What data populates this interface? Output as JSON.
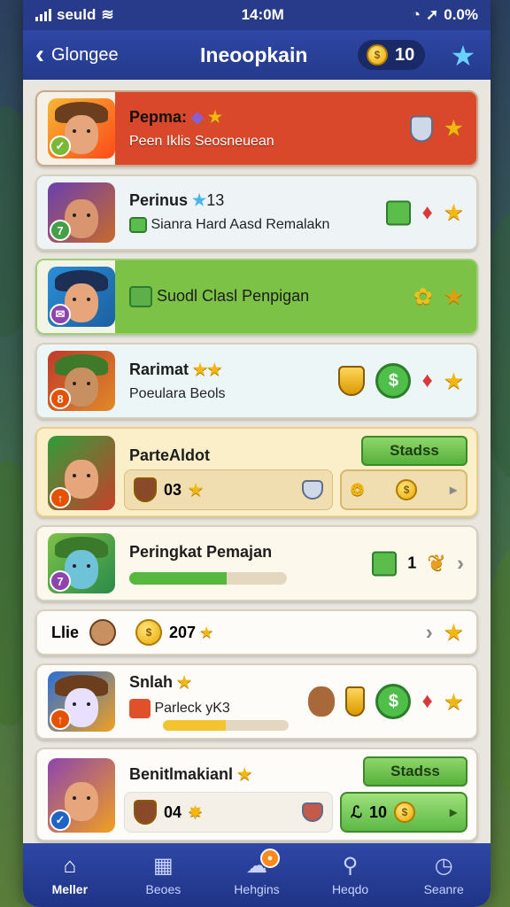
{
  "status_bar": {
    "carrier": "seuld",
    "time": "14:0M",
    "battery": "0.0%"
  },
  "header": {
    "back_label": "Glongee",
    "title": "Ineoopkain",
    "coins": "10"
  },
  "rows": [
    {
      "name": "Pepma:",
      "sub": "Peen Iklis Seosneuean",
      "badge_color": "#4caf50",
      "badge_icon": "✓"
    },
    {
      "name": "Perinus",
      "name_value": "13",
      "sub": "Sianra Hard Aasd Remalakn",
      "badge_color": "#43a047",
      "badge_icon": "7"
    },
    {
      "name": "Suodl Clasl Penpigan",
      "badge_color": "#8e44ad",
      "badge_icon": "✉"
    },
    {
      "name": "Rarimat",
      "sub": "Poeulara Beols",
      "badge_color": "#e65100",
      "badge_icon": "8"
    },
    {
      "name": "ParteAldot",
      "button": "Stadss",
      "inner_value": "03",
      "badge_color": "#e65100",
      "badge_icon": "↑"
    },
    {
      "name": "Peringkat Pemajan",
      "progress": 0.62,
      "count": "1",
      "badge_color": "#8e44ad",
      "badge_icon": "7"
    },
    {
      "name": "Llie",
      "value": "207"
    },
    {
      "name": "Snlah",
      "sub": "Parleck yK3",
      "progress": 0.5,
      "badge_color": "#e65100",
      "badge_icon": "↑"
    },
    {
      "name": "Benitlmakianl",
      "button": "Stadss",
      "inner_value": "04",
      "reward": "10",
      "badge_color": "#1e63c7",
      "badge_icon": "✓"
    }
  ],
  "nav": [
    {
      "label": "Meller",
      "icon": "home-icon"
    },
    {
      "label": "Beoes",
      "icon": "box-icon"
    },
    {
      "label": "Hehgins",
      "icon": "chat-icon"
    },
    {
      "label": "Heqdo",
      "icon": "search-icon"
    },
    {
      "label": "Seanre",
      "icon": "clock-icon"
    }
  ]
}
